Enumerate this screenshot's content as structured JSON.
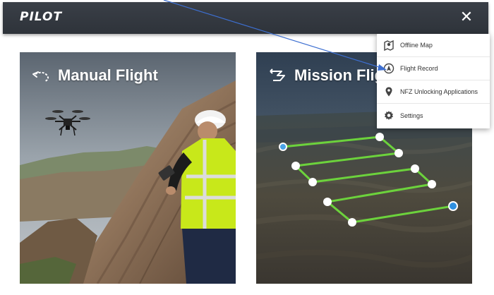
{
  "app": {
    "logo_text": "PILOT",
    "close_glyph": "✕"
  },
  "cards": [
    {
      "title": "Manual Flight",
      "icon": "manual-flight-icon"
    },
    {
      "title": "Mission Flig",
      "icon": "mission-flight-icon"
    }
  ],
  "menu": {
    "items": [
      {
        "label": "Offline Map",
        "icon": "offline-map-icon"
      },
      {
        "label": "Flight Record",
        "icon": "flight-record-icon"
      },
      {
        "label": "NFZ Unlocking Applications",
        "icon": "location-pin-icon"
      },
      {
        "label": "Settings",
        "icon": "gear-icon"
      }
    ]
  },
  "colors": {
    "topbar": "#333840",
    "flight_path": "#6cd23c",
    "waypoint": "#ffffff",
    "waypoint_active": "#2d8fe0",
    "annotation_arrow": "#3d6fd1",
    "vest": "#c8e81a"
  }
}
